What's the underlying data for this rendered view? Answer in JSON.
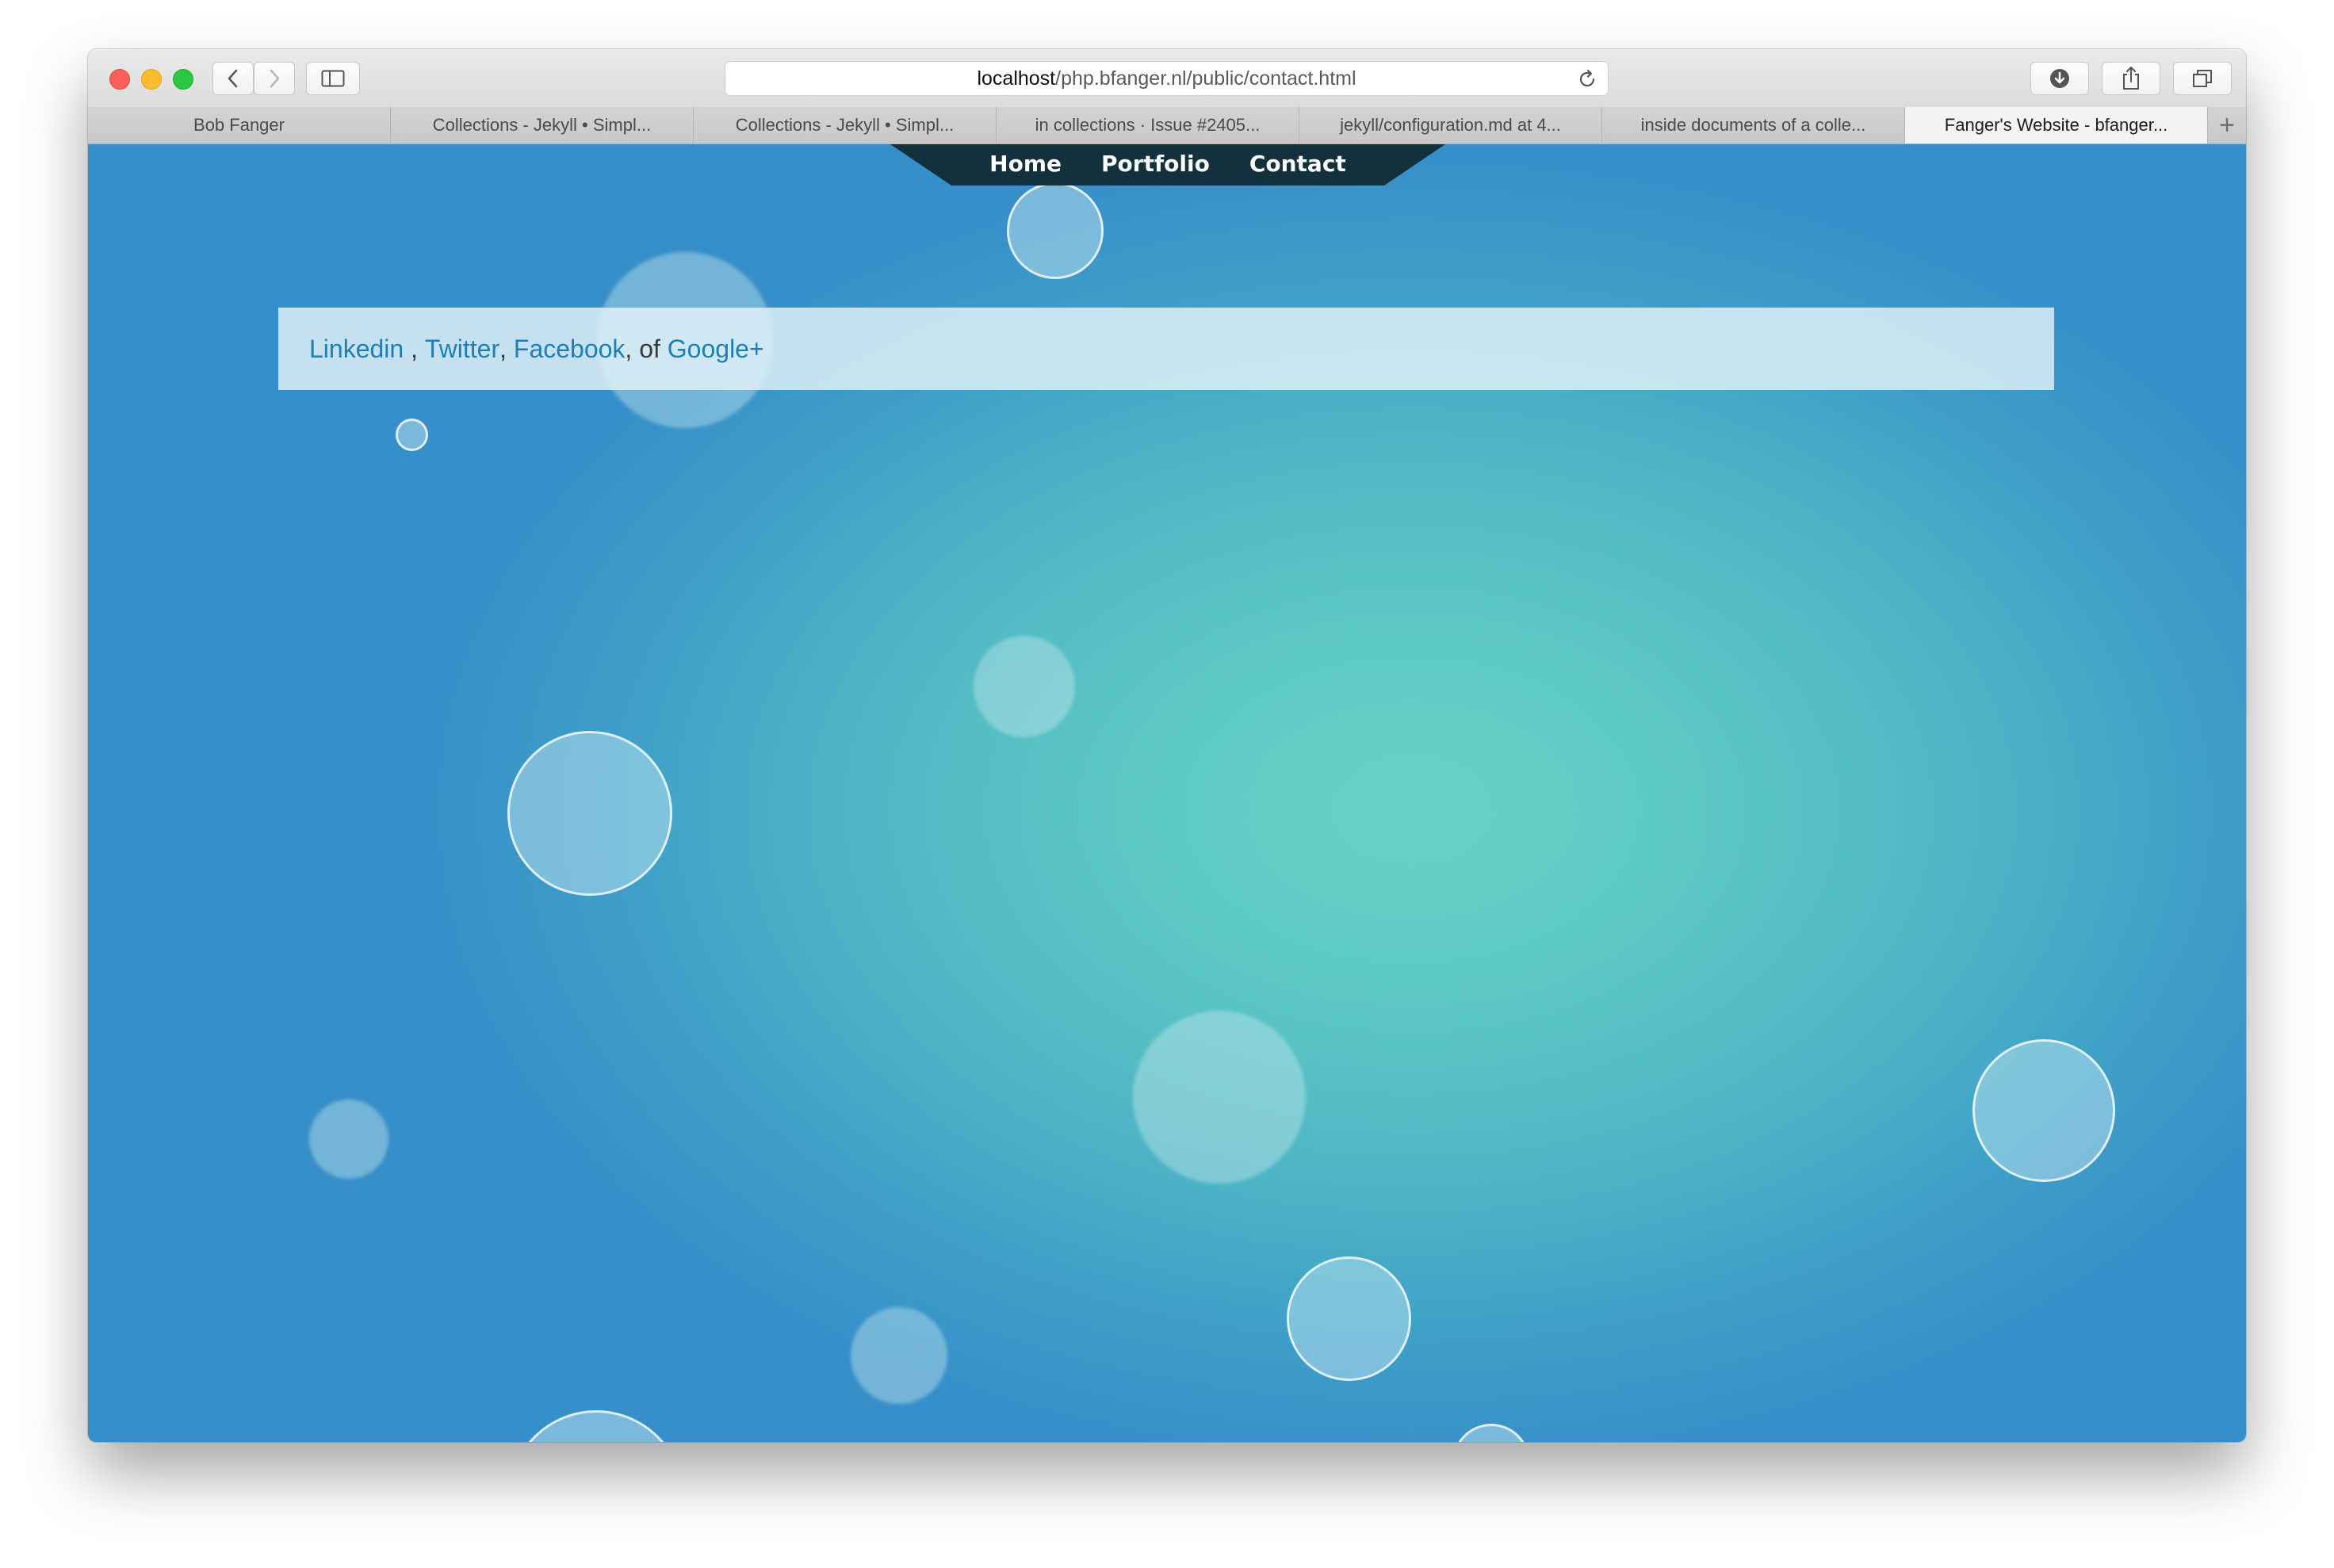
{
  "browser": {
    "url_host": "localhost",
    "url_path": "/php.bfanger.nl/public/contact.html",
    "tabs": [
      {
        "title": "Bob Fanger"
      },
      {
        "title": "Collections - Jekyll • Simpl..."
      },
      {
        "title": "Collections - Jekyll • Simpl..."
      },
      {
        "title": "in collections · Issue #2405..."
      },
      {
        "title": "jekyll/configuration.md at 4..."
      },
      {
        "title": "inside documents of a colle..."
      },
      {
        "title": "Fanger's Website - bfanger..."
      }
    ],
    "new_tab_symbol": "+",
    "icons": {
      "back": "chevron-left-icon",
      "forward": "chevron-right-icon",
      "sidebar": "sidebar-icon",
      "reload": "reload-icon",
      "downloads": "download-icon",
      "share": "share-icon",
      "tabs_overview": "tabs-overview-icon"
    }
  },
  "site": {
    "nav": {
      "home": "Home",
      "portfolio": "Portfolio",
      "contact": "Contact"
    },
    "contact": {
      "linkedin": "Linkedin",
      "sep1": " , ",
      "twitter": "Twitter",
      "sep2": ", ",
      "facebook": "Facebook",
      "sep3": ", of ",
      "google": "Google+"
    },
    "colors": {
      "nav_background": "#13303d",
      "link": "#1d7fb5",
      "background_center": "#66d2c6",
      "background_edge": "#378fc9"
    }
  }
}
